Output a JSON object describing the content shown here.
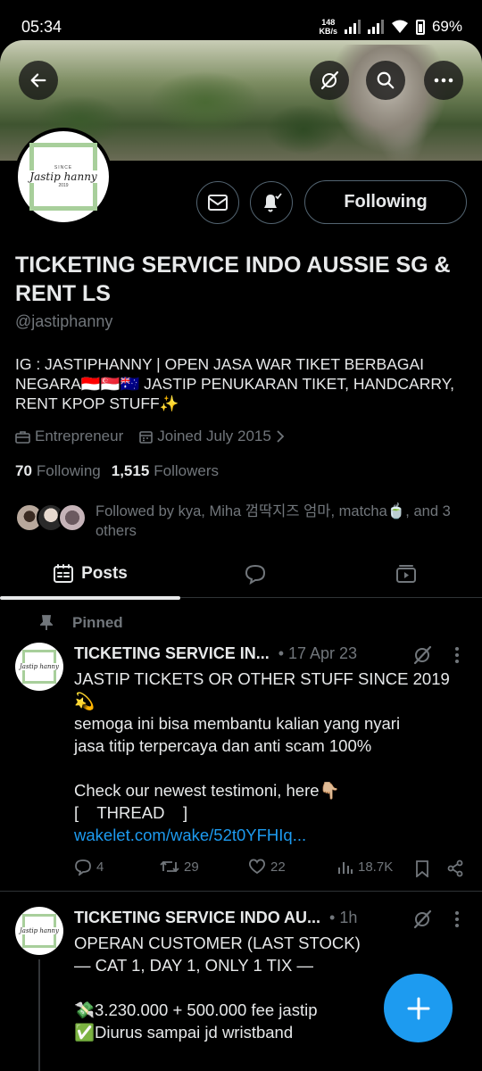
{
  "status_bar": {
    "time": "05:34",
    "net_speed_value": "148",
    "net_speed_unit": "KB/s",
    "battery": "69%"
  },
  "profile": {
    "logo_since": "SINCE",
    "logo_name": "Jastip hanny",
    "logo_year": "2019",
    "following_button": "Following",
    "name": "TICKETING SERVICE INDO AUSSIE SG & RENT LS",
    "handle": "@jastiphanny",
    "bio": "IG : JASTIPHANNY | OPEN JASA WAR TIKET BERBAGAI NEGARA🇮🇩🇸🇬🇦🇺 JASTIP PENUKARAN TIKET, HANDCARRY, RENT KPOP STUFF✨",
    "category": "Entrepreneur",
    "joined": "Joined July 2015",
    "following_count": "70",
    "following_label": "Following",
    "followers_count": "1,515",
    "followers_label": "Followers",
    "followed_by": "Followed by kya, Miha 껌딱지즈 엄마, matcha🍵, and 3 others"
  },
  "tabs": {
    "posts": "Posts"
  },
  "posts": [
    {
      "pinned_label": "Pinned",
      "author": "TICKETING SERVICE IN...",
      "date": "• 17 Apr 23",
      "lines": [
        "JASTIP TICKETS OR OTHER STUFF SINCE 2019",
        "💫",
        "semoga ini bisa membantu kalian yang nyari",
        "jasa titip terpercaya dan anti scam 100%",
        "Check our newest testimoni, here👇🏼",
        "[    THREAD    ]"
      ],
      "link": "wakelet.com/wake/52t0YFHIq...",
      "replies": "4",
      "reposts": "29",
      "likes": "22",
      "views": "18.7K"
    },
    {
      "author": "TICKETING SERVICE INDO AU...",
      "date": "• 1h",
      "lines": [
        "OPERAN CUSTOMER (LAST STOCK)",
        "— CAT 1, DAY 1, ONLY 1 TIX —",
        "💸3.230.000 + 500.000 fee jastip",
        "✅Diurus sampai jd wristband"
      ]
    }
  ],
  "colors": {
    "accent": "#1d9bf0",
    "muted": "#71767b",
    "border": "#2f3336",
    "logo_green": "#a8cf9b"
  }
}
